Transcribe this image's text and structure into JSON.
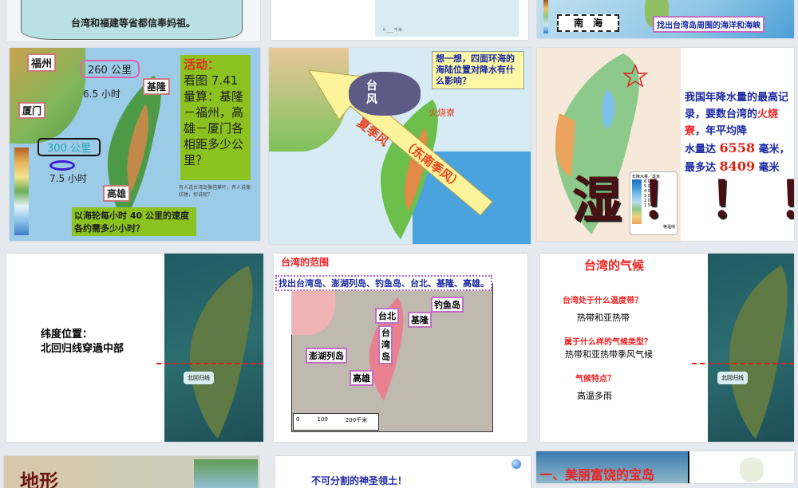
{
  "slides": [
    {
      "caption": "台湾和福建等省都信奉妈祖。"
    },
    {
      "scale": "0 ___ 千米"
    },
    {
      "sea_label": "南　海",
      "task": "找出台湾岛周围的海洋和海峡"
    },
    {
      "cities": [
        "福州",
        "基隆",
        "厦门",
        "高雄"
      ],
      "dist1": "260 公里",
      "time1": "6.5 小时",
      "dist2": "300 公里",
      "time2": "7.5 小时",
      "activity_title": "活动：",
      "activity_body": "看图 7.41 量算：基隆－福州，高雄－厦门各相距多少公里？",
      "question": "以海轮每小时 40 公里的速度各约需多少小时？",
      "note": "有人说台湾岛像芭蕉叶，有人说像纺锤，你说呢？"
    },
    {
      "think": "想一想，四面环海的海陆位置对降水有什么影响？",
      "typhoon": "台风",
      "wind1": "夏季风",
      "wind2": "（东南季风）",
      "place": "火烧寮"
    },
    {
      "text1": "我国年降水量的最高记录，要数台湾的",
      "place": "火烧寮",
      "text2": "，年平均降",
      "text3": "水量达",
      "avg": "6558",
      "unit": "毫米，",
      "text4": "最多达",
      "max": "8409",
      "unit2": "毫米",
      "big": "湿！！！",
      "legend_title": "年降水量／毫米",
      "legend": [
        "6 000",
        "5 000",
        "4 000",
        "3 000",
        "2 000",
        "1 500"
      ],
      "legend_line": "等温线",
      "colors": [
        "#1b6fbf",
        "#3d94d6",
        "#7cbfe8",
        "#b7dcef",
        "#8fc98a",
        "#f1d27a",
        "#e9a35c"
      ]
    },
    {
      "title": "纬度位置：",
      "body": "北回归线穿過中部",
      "callout": "北回归线"
    },
    {
      "title": "台湾的范围",
      "task": "找出台湾岛、澎湖列岛、钓鱼岛、台北、基隆、高雄。",
      "labels": [
        "钓鱼岛",
        "台北",
        "基隆",
        "台湾岛",
        "澎湖列岛",
        "高雄"
      ],
      "scale": [
        "0",
        "100",
        "200千米"
      ]
    },
    {
      "title": "台湾的气候",
      "q1": "台湾处于什么温度带？",
      "a1": "热带和亚热带",
      "q2": "属于什么样的气候类型？",
      "a2": "热带和亚热带季风气候",
      "q3": "气候特点？",
      "a3": "高温多雨",
      "callout": "北回归线"
    },
    {
      "title": "地形"
    },
    {
      "title": "不可分割的神圣领土！"
    },
    {
      "title": "一、美丽富饶的宝岛"
    }
  ]
}
